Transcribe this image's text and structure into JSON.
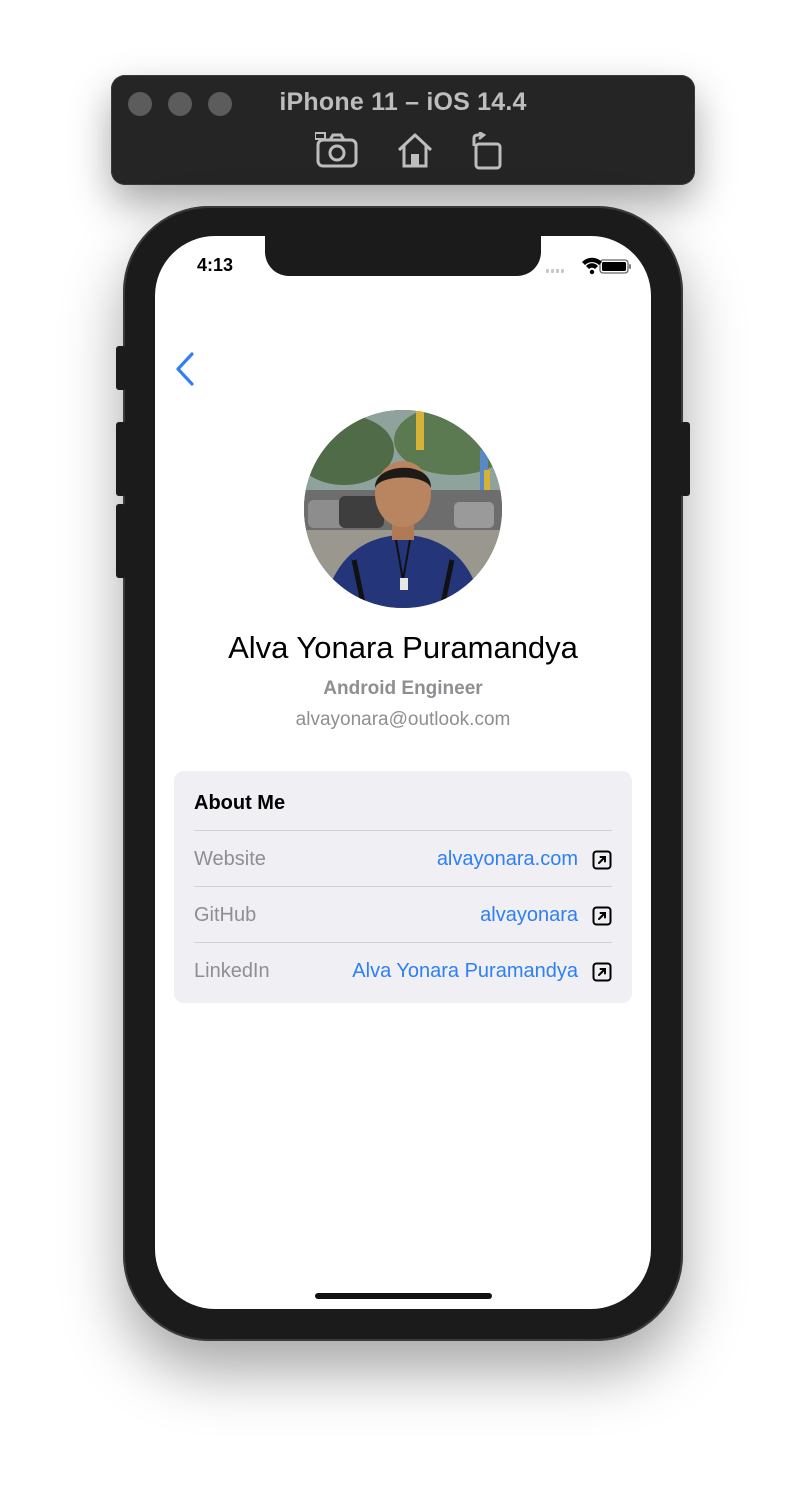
{
  "simulator": {
    "title": "iPhone 11 – iOS 14.4",
    "tools": [
      "camera-icon",
      "home-icon",
      "rotate-icon"
    ]
  },
  "status_bar": {
    "time": "4:13",
    "icons": [
      "signal-icon",
      "wifi-icon",
      "battery-icon"
    ]
  },
  "nav": {
    "back_icon": "chevron-left-icon"
  },
  "profile": {
    "name": "Alva Yonara Puramandya",
    "role": "Android Engineer",
    "email": "alvayonara@outlook.com"
  },
  "about": {
    "title": "About Me",
    "rows": [
      {
        "label": "Website",
        "value": "alvayonara.com",
        "icon": "external-link-icon"
      },
      {
        "label": "GitHub",
        "value": "alvayonara",
        "icon": "external-link-icon"
      },
      {
        "label": "LinkedIn",
        "value": "Alva Yonara Puramandya",
        "icon": "external-link-icon"
      }
    ]
  },
  "colors": {
    "accent": "#2f7ff5",
    "secondary_text": "#8e8e93",
    "card_background": "#efeff4"
  }
}
